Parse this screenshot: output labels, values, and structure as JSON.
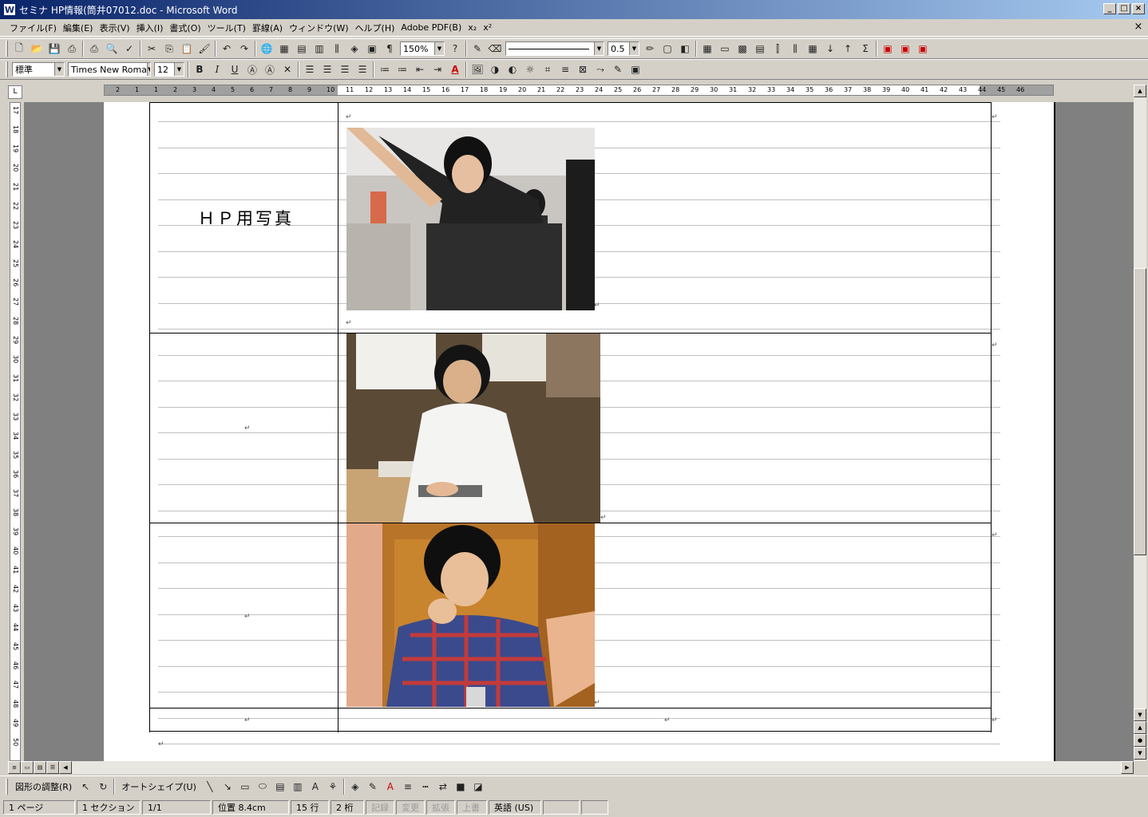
{
  "window": {
    "title": "セミナ  HP情報(筒井07012.doc - Microsoft Word",
    "minimize": "_",
    "maximize": "□",
    "close": "×"
  },
  "menu": [
    "ファイル(F)",
    "編集(E)",
    "表示(V)",
    "挿入(I)",
    "書式(O)",
    "ツール(T)",
    "罫線(A)",
    "ウィンドウ(W)",
    "ヘルプ(H)",
    "Adobe PDF(B)",
    "x₂",
    "x²"
  ],
  "doc_close": "×",
  "toolbar_standard": {
    "zoom": "150%",
    "line_width": "0.5"
  },
  "toolbar_format": {
    "style": "標準",
    "font": "Times New Roma",
    "size": "12",
    "bold": "B",
    "italic": "I",
    "underline": "U",
    "font_color": "A"
  },
  "ruler": {
    "h_ticks": [
      "2",
      "1",
      "1",
      "2",
      "3",
      "4",
      "5",
      "6",
      "7",
      "8",
      "9",
      "10",
      "11",
      "12",
      "13",
      "14",
      "15",
      "16",
      "17",
      "18",
      "19",
      "20",
      "21",
      "22",
      "23",
      "24",
      "25",
      "26",
      "27",
      "28",
      "29",
      "30",
      "31",
      "32",
      "33",
      "34",
      "35",
      "36",
      "37",
      "38",
      "39",
      "40",
      "41",
      "42",
      "43",
      "44",
      "45",
      "46"
    ],
    "v_ticks": [
      "17",
      "18",
      "19",
      "20",
      "21",
      "22",
      "23",
      "24",
      "25",
      "26",
      "27",
      "28",
      "29",
      "30",
      "31",
      "32",
      "33",
      "34",
      "35",
      "36",
      "37",
      "38",
      "39",
      "40",
      "41",
      "42",
      "43",
      "44",
      "45",
      "46",
      "47",
      "48",
      "49",
      "50"
    ],
    "corner": "L"
  },
  "document": {
    "cell_label": "ＨＰ用写真",
    "return_mark": "↵"
  },
  "drawing_toolbar": {
    "adjust": "図形の調整(R)",
    "autoshape": "オートシェイプ(U)"
  },
  "status_bar": {
    "page": "1 ページ",
    "section": "1 セクション",
    "page_of": "1/1",
    "position": "位置 8.4cm",
    "line": "15 行",
    "column": "2 桁",
    "rec": "記録",
    "trk": "変更",
    "ext": "拡張",
    "ovr": "上書",
    "lang": "英語 (US)"
  },
  "colors": {
    "titlebar_start": "#0a246a",
    "titlebar_end": "#a6caf0",
    "chrome": "#d4d0c8",
    "workspace": "#808080"
  },
  "icons": [
    "new-icon",
    "open-icon",
    "save-icon",
    "permission-icon",
    "print-icon",
    "preview-icon",
    "spell-icon",
    "cut-icon",
    "copy-icon",
    "paste-icon",
    "format-painter-icon",
    "undo-icon",
    "redo-icon",
    "hyperlink-icon",
    "table-icon",
    "excel-icon",
    "columns-icon",
    "drawing-icon",
    "docmap-icon",
    "showhide-icon",
    "help-icon"
  ]
}
